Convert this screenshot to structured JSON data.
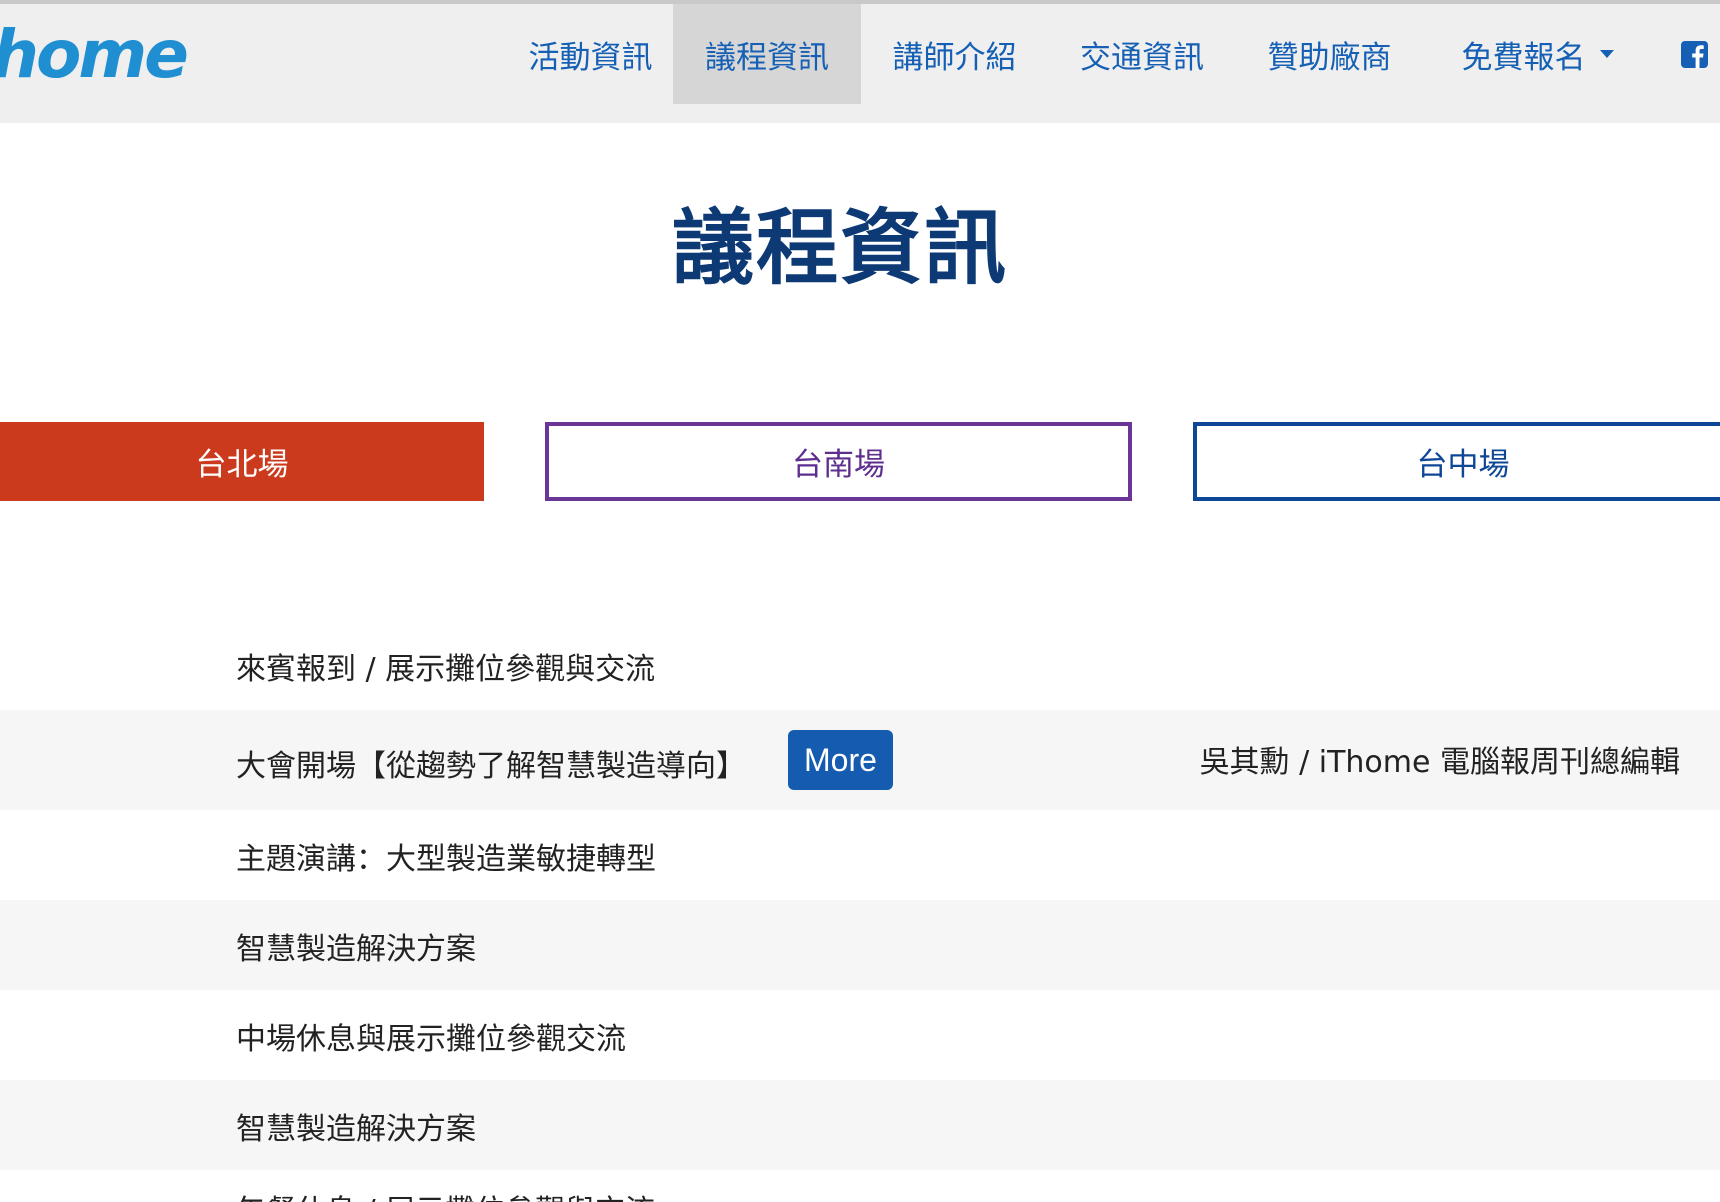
{
  "header": {
    "logo_text": "home",
    "nav": [
      {
        "label": "活動資訊"
      },
      {
        "label": "議程資訊",
        "active": true
      },
      {
        "label": "講師介紹"
      },
      {
        "label": "交通資訊"
      },
      {
        "label": "贊助廠商"
      },
      {
        "label": "免費報名",
        "has_dropdown": true
      }
    ],
    "social_icon": "facebook-icon"
  },
  "page": {
    "title": "議程資訊"
  },
  "tabs": [
    {
      "label": "台北場",
      "active": true,
      "color": "#cb3a1d"
    },
    {
      "label": "台南場",
      "color": "#6a3595"
    },
    {
      "label": "台中場",
      "color": "#0f4797"
    }
  ],
  "agenda": [
    {
      "title": "來賓報到 / 展示攤位參觀與交流"
    },
    {
      "title": "大會開場【從趨勢了解智慧製造導向】",
      "more_label": "More",
      "speaker": "吳其勳 / iThome 電腦報周刊總編輯"
    },
    {
      "title": "主題演講：大型製造業敏捷轉型"
    },
    {
      "title": "智慧製造解決方案"
    },
    {
      "title": "中場休息與展示攤位參觀交流"
    },
    {
      "title": "智慧製造解決方案"
    },
    {
      "title": "午餐休息 / 展示攤位參觀與交流"
    }
  ],
  "colors": {
    "nav_text": "#1560b5",
    "title": "#0d3a75",
    "more_button": "#155bb0"
  }
}
